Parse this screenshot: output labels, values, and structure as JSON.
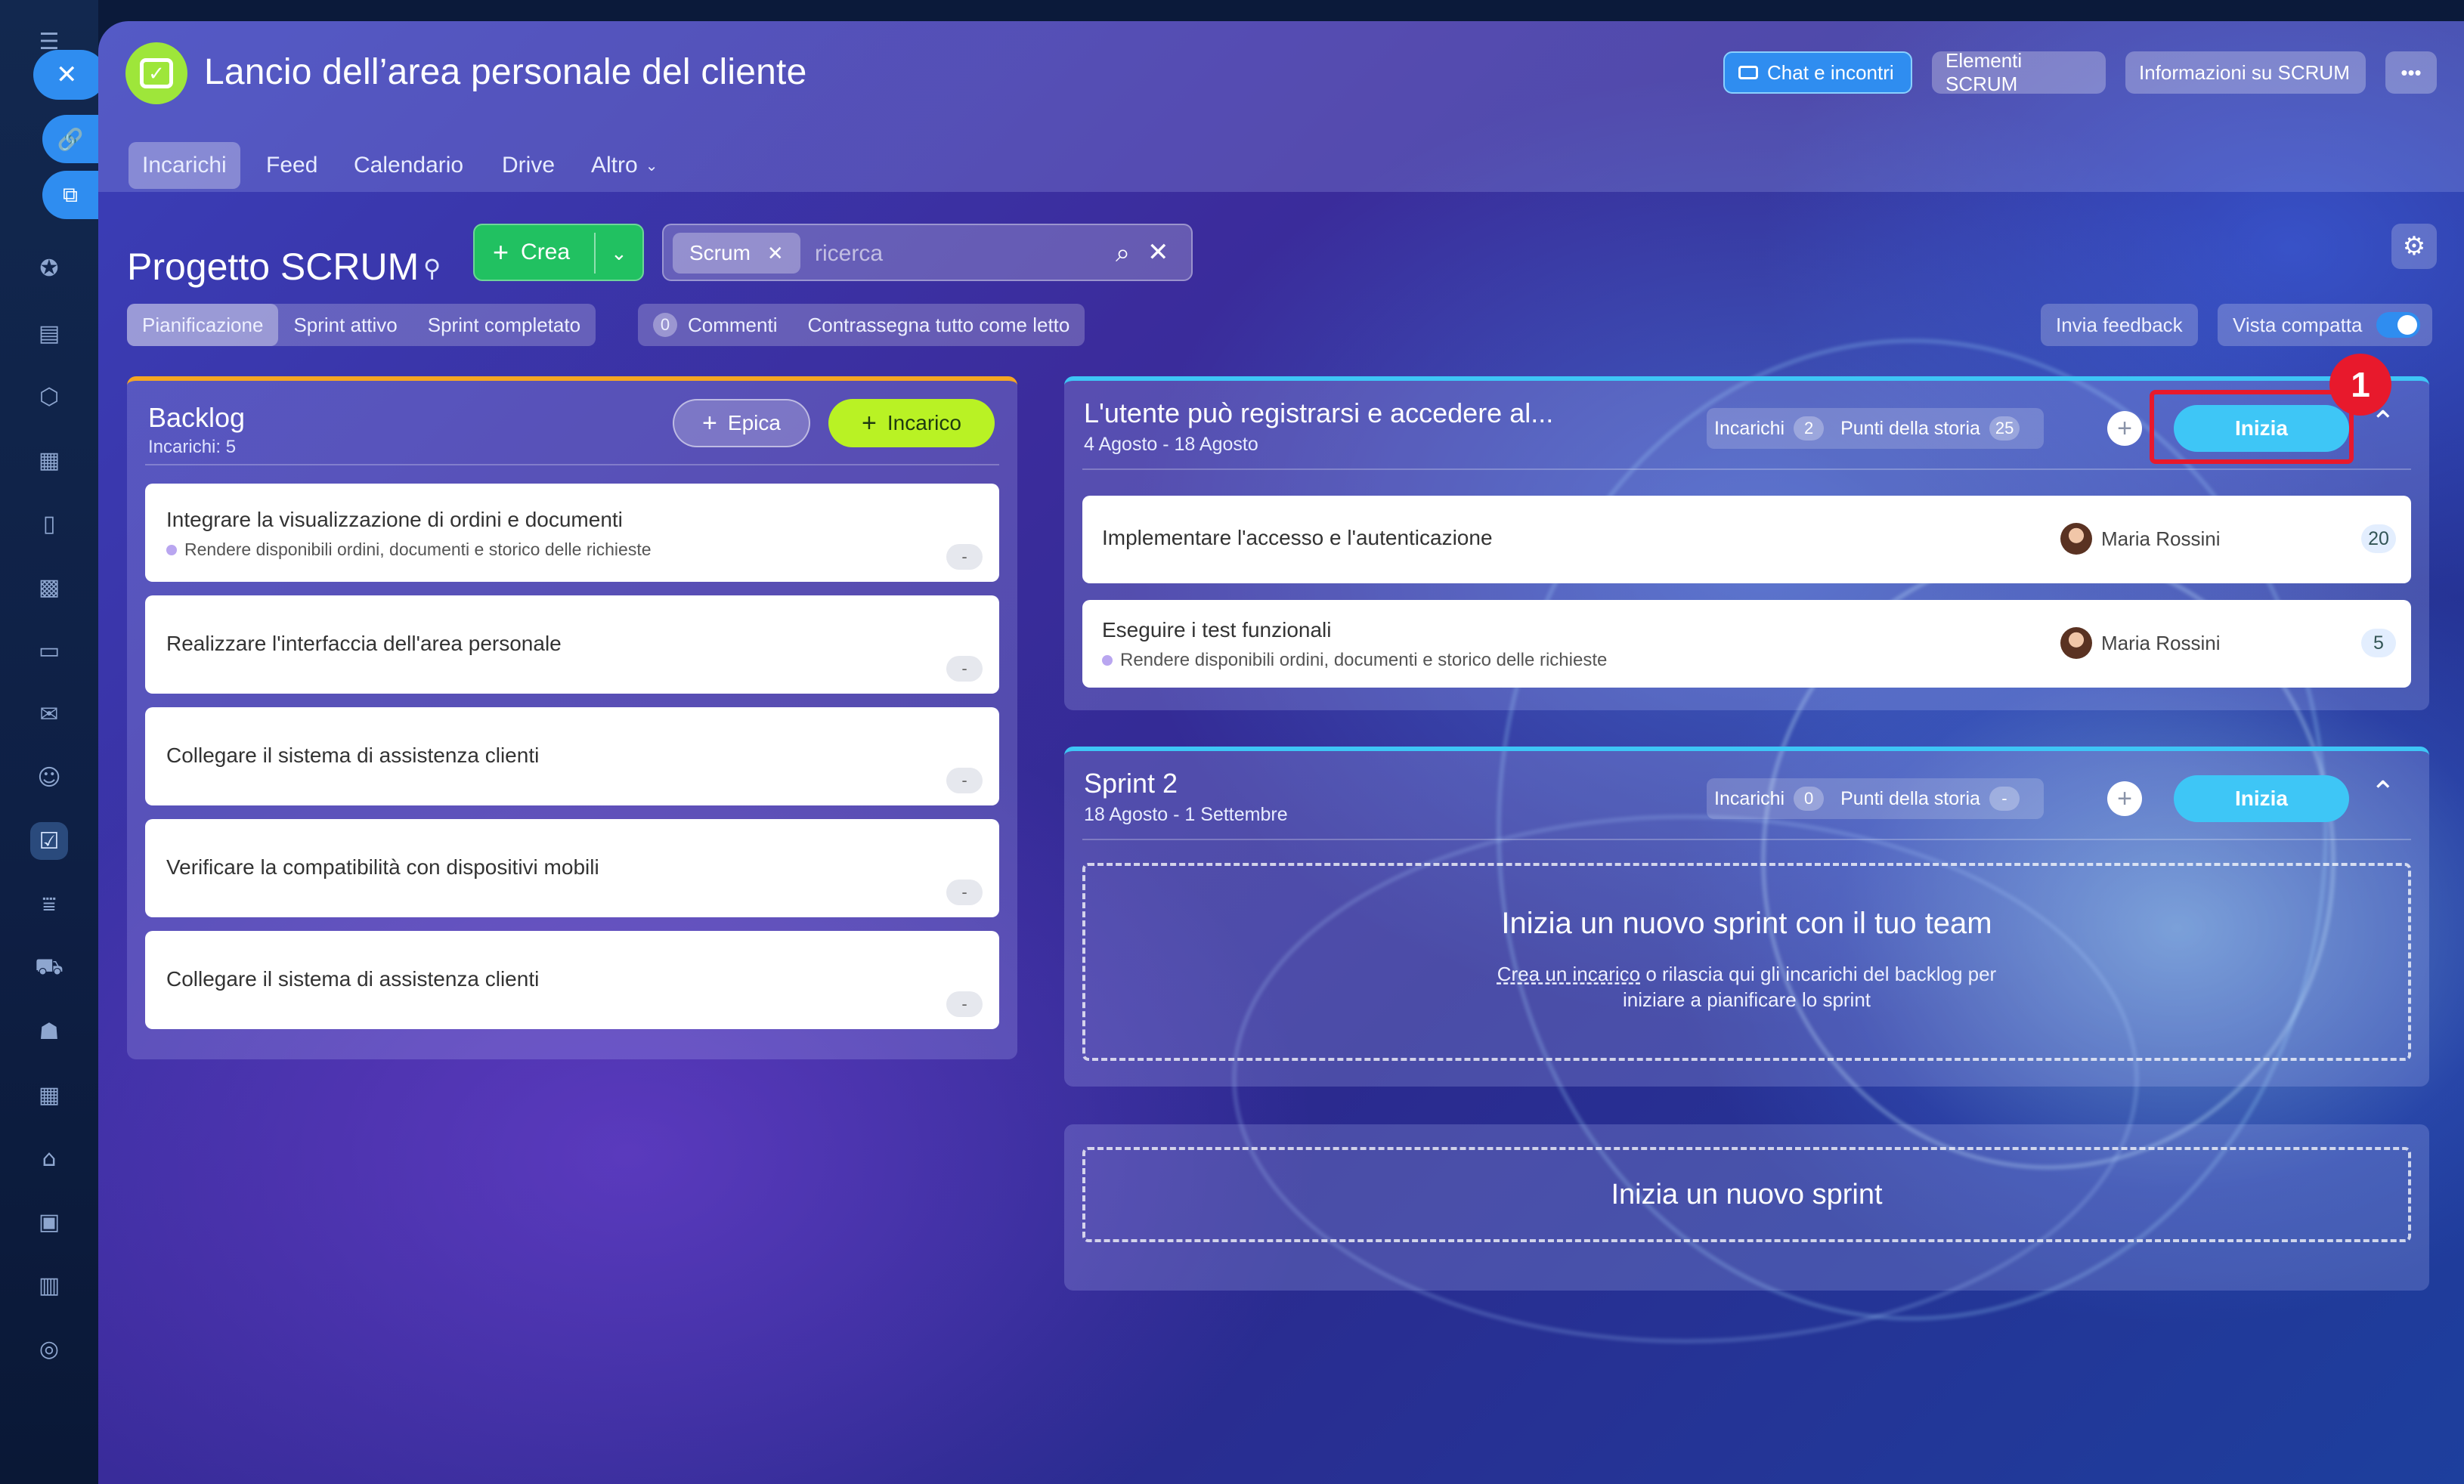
{
  "header": {
    "title": "Lancio dell’area personale del cliente",
    "buttons": {
      "chat": "Chat e incontri",
      "elements": "Elementi SCRUM",
      "info": "Informazioni su SCRUM",
      "more": "•••"
    },
    "tabs": [
      {
        "label": "Incarichi"
      },
      {
        "label": "Feed"
      },
      {
        "label": "Calendario"
      },
      {
        "label": "Drive"
      },
      {
        "label": "Altro"
      }
    ]
  },
  "toolbar": {
    "page_title": "Progetto SCRUM",
    "create_label": "Crea",
    "search_chip": "Scrum",
    "search_placeholder": "ricerca",
    "views": [
      "Pianificazione",
      "Sprint attivo",
      "Sprint completato"
    ],
    "comments_count": "0",
    "comments_label": "Commenti",
    "mark_read": "Contrassegna tutto come letto",
    "feedback": "Invia feedback",
    "compact_view": "Vista compatta",
    "compact_on": true
  },
  "backlog": {
    "title": "Backlog",
    "subtitle": "Incarichi: 5",
    "epic_btn": "Epica",
    "task_btn": "Incarico",
    "items": [
      {
        "title": "Integrare la visualizzazione di ordini e documenti",
        "epic": "Rendere disponibili ordini, documenti e storico delle richieste",
        "points": "-"
      },
      {
        "title": "Realizzare l'interfaccia dell'area personale",
        "epic": "",
        "points": "-"
      },
      {
        "title": "Collegare il sistema di assistenza clienti",
        "epic": "",
        "points": "-"
      },
      {
        "title": "Verificare la compatibilità con dispositivi mobili",
        "epic": "",
        "points": "-"
      },
      {
        "title": "Collegare il sistema di assistenza clienti",
        "epic": "",
        "points": "-"
      }
    ]
  },
  "sprint1": {
    "title": "L'utente può registrarsi e accedere al...",
    "dates": "4 Agosto - 18 Agosto",
    "tasks_label": "Incarichi",
    "tasks_count": "2",
    "points_label": "Punti della storia",
    "points_count": "25",
    "start": "Inizia",
    "annotation": "1",
    "tasks": [
      {
        "title": "Implementare l'accesso e l'autenticazione",
        "epic": "",
        "assignee": "Maria Rossini",
        "points": "20"
      },
      {
        "title": "Eseguire i test funzionali",
        "epic": "Rendere disponibili ordini, documenti e storico delle richieste",
        "assignee": "Maria Rossini",
        "points": "5"
      }
    ]
  },
  "sprint2": {
    "title": "Sprint 2",
    "dates": "18 Agosto - 1 Settembre",
    "tasks_label": "Incarichi",
    "tasks_count": "0",
    "points_label": "Punti della storia",
    "points_count": "-",
    "start": "Inizia",
    "empty_title": "Inizia un nuovo sprint con il tuo team",
    "empty_link": "Crea un incarico",
    "empty_rest": " o rilascia qui gli incarichi del backlog per",
    "empty_line2": "iniziare a pianificare lo sprint"
  },
  "new_sprint": {
    "label": "Inizia un nuovo sprint"
  },
  "colors": {
    "accent": "#2f8df0",
    "create_green": "#21c161",
    "task_lime": "#b9f224",
    "sprint_cyan": "#3ec6f6",
    "backlog_orange": "#f5a623",
    "annotation_red": "#e8192c"
  }
}
